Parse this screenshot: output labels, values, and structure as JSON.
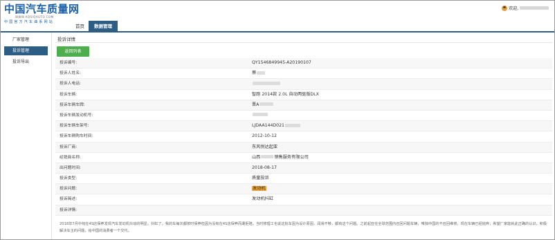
{
  "header": {
    "logo_title": "中国汽车质量网",
    "logo_url": "WWW.AQSIQAUTO.COM",
    "logo_sub": "中国官方汽车曲系网站",
    "nav": [
      {
        "label": "首页",
        "active": false
      },
      {
        "label": "数据管理",
        "active": true
      }
    ],
    "user_greeting": "欢迎,"
  },
  "sidebar": {
    "items": [
      {
        "label": "厂家管理",
        "active": false
      },
      {
        "label": "投诉管理",
        "active": true
      },
      {
        "label": "投诉导出",
        "active": false
      }
    ]
  },
  "main": {
    "section_title": "投诉详情",
    "back_button": "返回列表",
    "rows": [
      {
        "label": "投诉编号:",
        "value": "QY1546849945-A20190107"
      },
      {
        "label": "投诉人姓名:",
        "value": "蔡"
      },
      {
        "label": "投诉人电话:",
        "value": ""
      },
      {
        "label": "投诉车辆:",
        "value": "智跑 2014款 2.0L 自动两驱版DLX"
      },
      {
        "label": "投诉车辆车牌:",
        "value": "晋A"
      },
      {
        "label": "投诉车辆发动机号:",
        "value": ""
      },
      {
        "label": "投诉车辆车架号:",
        "value": "LJDAA144D021"
      },
      {
        "label": "投诉车辆购车时间:",
        "value": "2012-10-12"
      },
      {
        "label": "投诉厂商:",
        "value": "东风悦达起亚"
      },
      {
        "label": "经销商名称:",
        "value_prefix": "山西",
        "value": "销售服务有限公司"
      },
      {
        "label": "出问题时间:",
        "value": "2018-08-17"
      },
      {
        "label": "投诉类型:",
        "value": "质量投诉"
      },
      {
        "label": "投诉问题:",
        "value": "发动机"
      },
      {
        "label": "投诉简述:",
        "value": "发动机抖缸"
      },
      {
        "label": "投诉详情:",
        "value": ""
      }
    ],
    "detail_text": "2018年7月中旬在4S店保养发现汽车发动机抖动的明显。抖缸了。我的车每次都按时保养但因为没有在4S店保养而遭拒赔。当时修理工也说这批车因为设计原因，润滑不够，都有这个问题。之前起亚在全球范围内召回问题车辆，唯独中国的不召回维修。现在车辆已经抛弃，希望厂家能就此正确的认识，积极解决车主的问题，给中国的消费者一个交代。"
  },
  "colors": {
    "brand_blue": "#2c5d84",
    "logo_blue": "#1a5fa8",
    "button_green": "#4cae4c",
    "highlight_orange": "#e8a640"
  }
}
